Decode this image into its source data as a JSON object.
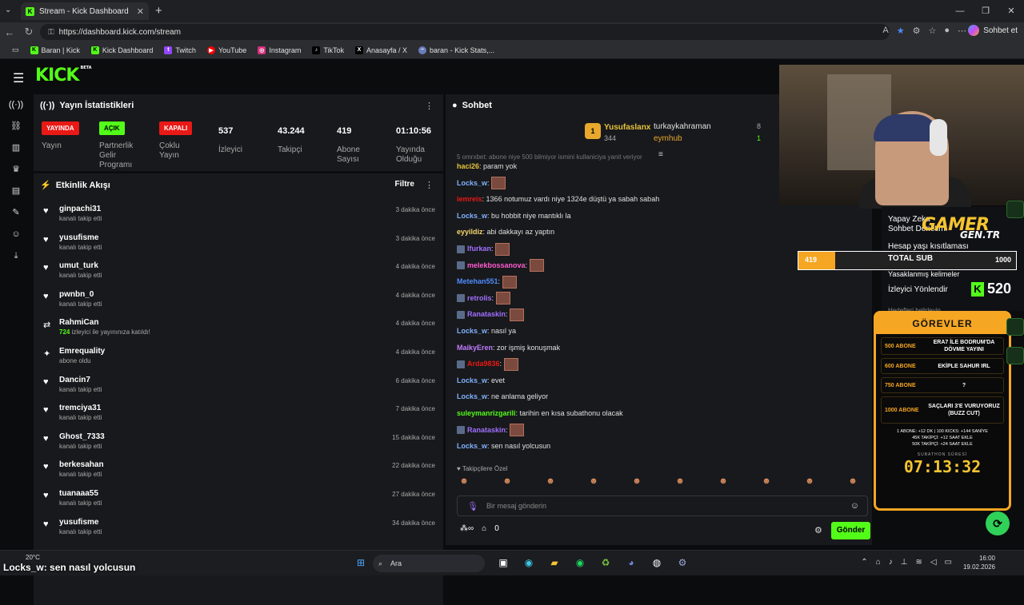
{
  "browser": {
    "tab_title": "Stream - Kick Dashboard",
    "url": "https://dashboard.kick.com/stream",
    "copilot_label": "Sohbet et",
    "bookmarks": [
      "Baran | Kick",
      "Kick Dashboard",
      "Twitch",
      "YouTube",
      "Instagram",
      "TikTok",
      "Anasayfa / X",
      "baran - Kick Stats,..."
    ]
  },
  "app": {
    "logo": "KICK",
    "logo_beta": "BETA"
  },
  "stats": {
    "title": "Yayın İstatistikleri",
    "items": [
      {
        "badge": "YAYINDA",
        "label": "Yayın"
      },
      {
        "badge": "AÇIK",
        "label": "Partnerlik Gelir Programı"
      },
      {
        "badge": "KAPALI",
        "label": "Çoklu Yayın"
      },
      {
        "value": "537",
        "label": "İzleyici"
      },
      {
        "value": "43.244",
        "label": "Takipçi"
      },
      {
        "value": "419",
        "label": "Abone Sayısı"
      },
      {
        "value": "01:10:56",
        "label": "Yayında Olduğu Süre"
      }
    ]
  },
  "activity": {
    "title": "Etkinlik Akışı",
    "filter_label": "Filtre",
    "items": [
      {
        "name": "ginpachi31",
        "sub": "kanalı takip etti",
        "time": "3 dakika önce",
        "icon": "heart-icon"
      },
      {
        "name": "yusufisme",
        "sub": "kanalı takip etti",
        "time": "3 dakika önce",
        "icon": "heart-icon"
      },
      {
        "name": "umut_turk",
        "sub": "kanalı takip etti",
        "time": "4 dakika önce",
        "icon": "heart-icon"
      },
      {
        "name": "pwnbn_0",
        "sub": "kanalı takip etti",
        "time": "4 dakika önce",
        "icon": "heart-icon"
      },
      {
        "name": "RahmiCan",
        "sub_count": "724",
        "sub": "izleyici ile yayınınıza katıldı!",
        "time": "4 dakika önce",
        "icon": "raid-icon"
      },
      {
        "name": "Emrequality",
        "sub": "abone oldu",
        "time": "4 dakika önce",
        "icon": "sparkle-icon"
      },
      {
        "name": "Dancin7",
        "sub": "kanalı takip etti",
        "time": "6 dakika önce",
        "icon": "heart-icon"
      },
      {
        "name": "tremciya31",
        "sub": "kanalı takip etti",
        "time": "7 dakika önce",
        "icon": "heart-icon"
      },
      {
        "name": "Ghost_7333",
        "sub": "kanalı takip etti",
        "time": "15 dakika önce",
        "icon": "heart-icon"
      },
      {
        "name": "berkesahan",
        "sub": "kanalı takip etti",
        "time": "22 dakika önce",
        "icon": "heart-icon"
      },
      {
        "name": "tuanaaa55",
        "sub": "kanalı takip etti",
        "time": "27 dakika önce",
        "icon": "heart-icon"
      },
      {
        "name": "yusufisme",
        "sub": "kanalı takip etti",
        "time": "34 dakika önce",
        "icon": "heart-icon"
      }
    ]
  },
  "chat": {
    "title": "Sohbet",
    "leaderboard": {
      "rank": "1",
      "top_name": "Yusufaslanx",
      "top_value": "344",
      "r1_name": "turkaykahraman",
      "r1_value": "8",
      "r2_name": "eymhub",
      "r2_value": "1"
    },
    "faded_line": "5 omrxbet: abone niye 500 bilmiyor ismini kullaniciya yanit veriyor",
    "messages": [
      {
        "user": "haci26",
        "color": "#e7c43a",
        "text": "param yok"
      },
      {
        "user": "Locks_w",
        "color": "#7fb2ff",
        "text": "",
        "emote": true
      },
      {
        "user": "iemreis",
        "color": "#e91916",
        "text": "1366 notumuz vardı niye 1324e düştü ya sabah sabah"
      },
      {
        "user": "Locks_w",
        "color": "#7fb2ff",
        "text": "bu hobbit niye mantıklı la"
      },
      {
        "user": "eyyildiz",
        "color": "#f5d76e",
        "text": "abi dakkayı az yaptın"
      },
      {
        "user": "Ifurkan",
        "color": "#a070ff",
        "text": "",
        "emote": true,
        "badge": true
      },
      {
        "user": "melekbossanova",
        "color": "#ff5bd1",
        "text": "",
        "emote": true,
        "badge": true
      },
      {
        "user": "Metehan551",
        "color": "#4f8cff",
        "text": "",
        "emote": true
      },
      {
        "user": "retrolis",
        "color": "#a070ff",
        "text": "",
        "emote": true,
        "badge": true
      },
      {
        "user": "Ranataskin",
        "color": "#a070ff",
        "text": "",
        "emote": true,
        "badge": true
      },
      {
        "user": "Locks_w",
        "color": "#7fb2ff",
        "text": "nasıl ya"
      },
      {
        "user": "MaikyEren",
        "color": "#c07cff",
        "text": "zor işmiş konuşmak"
      },
      {
        "user": "Arda9836",
        "color": "#e91916",
        "text": "",
        "emote": true,
        "badge": true
      },
      {
        "user": "Locks_w",
        "color": "#7fb2ff",
        "text": "evet"
      },
      {
        "user": "Locks_w",
        "color": "#7fb2ff",
        "text": "ne anlama geliyor"
      },
      {
        "user": "suleymanrizgarili",
        "color": "#53fc18",
        "text": "tarihin en kısa subathonu olacak"
      },
      {
        "user": "Ranataskin",
        "color": "#a070ff",
        "text": "",
        "emote": true,
        "badge": true
      },
      {
        "user": "Locks_w",
        "color": "#7fb2ff",
        "text": "sen nasıl yolcusun"
      }
    ],
    "followers_label": "Takipçilere Özel",
    "input_placeholder": "Bir mesaj gönderin",
    "points": "0",
    "send_label": "Gönder"
  },
  "overlay": {
    "lines": [
      "Yapay Zeka",
      "Sohbet Denetimi",
      "Hesap yaşı kısıtlaması",
      "Yasaklanmış kelimeler",
      "İzleyici Yönlendir",
      "Hedefleri belirleyin"
    ],
    "brand": "GAMER",
    "brand_sub": "GEN.TR",
    "sub_current": "419",
    "sub_label": "TOTAL SUB",
    "sub_goal": "1000",
    "sub_progress": 0.419,
    "kick_count": "520",
    "missions_title": "GÖREVLER",
    "missions": [
      {
        "goal": "500 ABONE",
        "task": "ERA7 İLE BODRUM'DA DÖVME YAYINI"
      },
      {
        "goal": "600 ABONE",
        "task": "EKİPLE SAHUR IRL"
      },
      {
        "goal": "750 ABONE",
        "task": "?"
      },
      {
        "goal": "1000 ABONE",
        "task": "SAÇLARI 3'E VURUYORUZ (BUZZ CUT)"
      }
    ],
    "rules": [
      "1 ABONE: +12 DK | 100 KICKS: +144 SANİYE",
      "45K TAKİPÇİ: +12 SAAT EKLE",
      "50K TAKİPÇİ: +24 SAAT EKLE"
    ],
    "timer_label": "SUBATHON SÜRESİ",
    "timer": "07:13:32"
  },
  "taskbar": {
    "weather": "20°C",
    "caption": "Locks_w: sen nasıl yolcusun",
    "search": "Ara",
    "time": "16:00",
    "date": "19.02.2026"
  },
  "colors": {
    "kick_green": "#53fc18",
    "live_red": "#e91916",
    "panel": "#18191c",
    "accent_orange": "#f5a623"
  }
}
